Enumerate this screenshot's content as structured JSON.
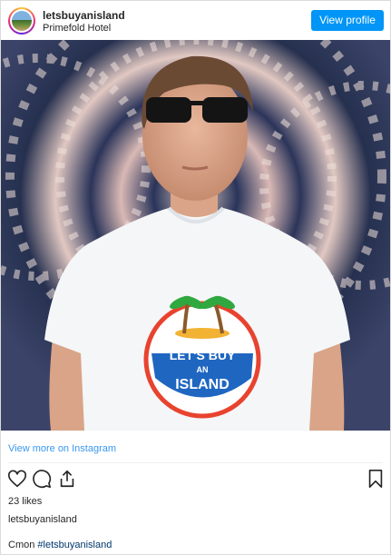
{
  "header": {
    "username": "letsbuyanisland",
    "location": "Primefold Hotel",
    "view_profile_label": "View profile"
  },
  "post": {
    "tshirt_line1": "LET'S BUY",
    "tshirt_line2": "AN",
    "tshirt_line3": "ISLAND",
    "view_more_label": "View more on Instagram",
    "likes": "23 likes",
    "caption_username": "letsbuyanisland",
    "caption_text": "Cmon ",
    "caption_hashtag": "#letsbuyanisland"
  },
  "icons": {
    "like": "heart-icon",
    "comment": "comment-icon",
    "share": "share-icon",
    "save": "bookmark-icon"
  },
  "colors": {
    "button": "#0095f6",
    "link": "#3897f0",
    "hashtag": "#00376b"
  }
}
